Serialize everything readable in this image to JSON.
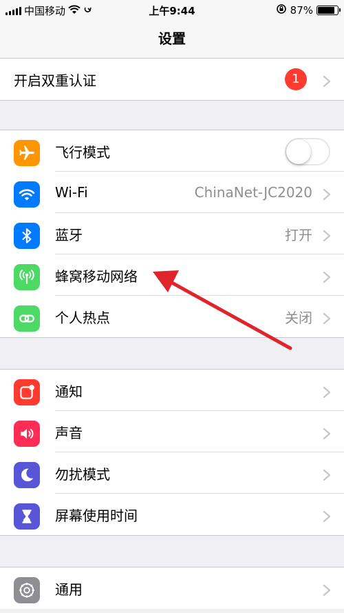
{
  "status_bar": {
    "carrier": "中国移动",
    "time": "上午9:44",
    "battery": "87%",
    "battery_level": 0.87
  },
  "nav": {
    "title": "设置"
  },
  "two_factor": {
    "label": "开启双重认证",
    "badge": "1"
  },
  "group1": [
    {
      "label": "飞行模式",
      "icon": "airplane-icon",
      "color": "#ff9500",
      "toggle": false
    },
    {
      "label": "Wi-Fi",
      "icon": "wifi-icon",
      "color": "#007aff",
      "value": "ChinaNet-JC2020"
    },
    {
      "label": "蓝牙",
      "icon": "bluetooth-icon",
      "color": "#007aff",
      "value": "打开"
    },
    {
      "label": "蜂窝移动网络",
      "icon": "cellular-icon",
      "color": "#4cd964"
    },
    {
      "label": "个人热点",
      "icon": "hotspot-icon",
      "color": "#4cd964",
      "value": "关闭"
    }
  ],
  "group2": [
    {
      "label": "通知",
      "icon": "notification-icon",
      "color": "#ff3b30"
    },
    {
      "label": "声音",
      "icon": "sound-icon",
      "color": "#ff2d55"
    },
    {
      "label": "勿扰模式",
      "icon": "moon-icon",
      "color": "#5856d6"
    },
    {
      "label": "屏幕使用时间",
      "icon": "hourglass-icon",
      "color": "#5856d6"
    }
  ],
  "group3": [
    {
      "label": "通用",
      "icon": "gear-icon",
      "color": "#8e8e93"
    }
  ],
  "colors": {
    "background": "#efeff4",
    "annotation_arrow": "#e0242b"
  }
}
